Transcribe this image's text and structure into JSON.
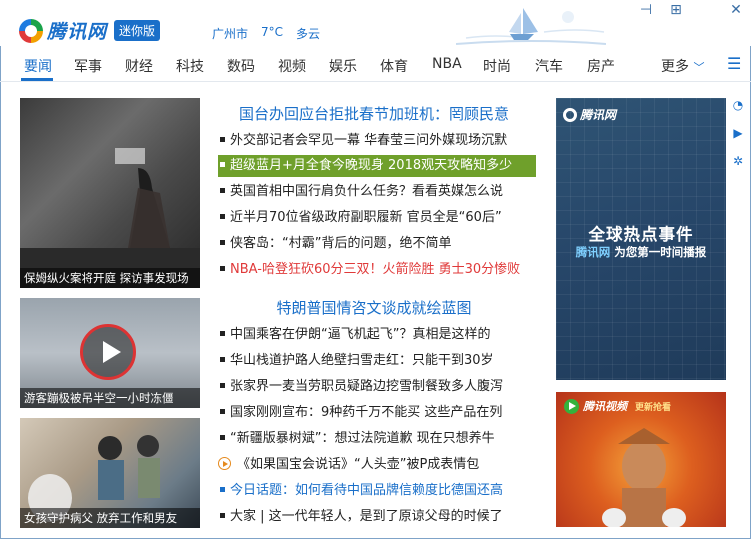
{
  "header": {
    "logo_text": "腾讯网",
    "edition_badge": "迷你版",
    "weather": {
      "city": "广州市",
      "temperature": "7°C",
      "condition": "多云"
    },
    "window_controls": [
      "pin-icon",
      "maximize-icon",
      "close-icon"
    ]
  },
  "nav": {
    "items": [
      "要闻",
      "军事",
      "财经",
      "科技",
      "数码",
      "视频",
      "娱乐",
      "体育",
      "NBA",
      "时尚",
      "汽车",
      "房产"
    ],
    "active_index": 0,
    "more_label": "更多"
  },
  "photos": [
    {
      "caption": "保姆纵火案将开庭 探访事发现场"
    },
    {
      "caption": "游客蹦极被吊半空一小时冻僵"
    },
    {
      "caption": "女孩守护病父 放弃工作和男友"
    }
  ],
  "news": {
    "section1": {
      "headline": "国台办回应台拒批春节加班机：罔顾民意",
      "items": [
        "外交部记者会罕见一幕 华春莹三问外媒现场沉默",
        "超级蓝月+月全食今晚现身 2018观天攻略知多少",
        "英国首相中国行肩负什么任务？看看英媒怎么说",
        "近半月70位省级政府副职履新 官员全是“60后”",
        "侠客岛：“村霸”背后的问题，绝不简单",
        "NBA-哈登狂砍60分三双！火箭险胜 勇士30分惨败"
      ]
    },
    "section2": {
      "headline": "特朗普国情咨文谈成就绘蓝图",
      "items": [
        "中国乘客在伊朗“逼飞机起飞”？真相是这样的",
        "华山栈道护路人绝壁扫雪走红：只能干到30岁",
        "张家界一麦当劳职员疑路边挖雪制餐致多人腹泻",
        "国家刚刚宣布：9种药千万不能买 这些产品在列",
        "“新疆版暴树斌”：想过法院道歉 现在只想养牛",
        "《如果国宝会说话》“人头壶”被P成表情包",
        "今日话题：如何看待中国品牌信赖度比德国还高",
        "大家 | 这一代年轻人，是到了原谅父母的时候了"
      ]
    }
  },
  "ads": {
    "ad1": {
      "logo": "腾讯网",
      "title": "全球热点事件",
      "sub_brand": "腾讯网",
      "sub_text": "为您第一时间播报"
    },
    "ad2": {
      "logo": "腾讯视频",
      "tag": "更新抢看"
    }
  },
  "colors": {
    "brand_blue": "#1a6fc9",
    "highlight_green": "#6fa02b",
    "alert_red": "#e03a3a"
  }
}
